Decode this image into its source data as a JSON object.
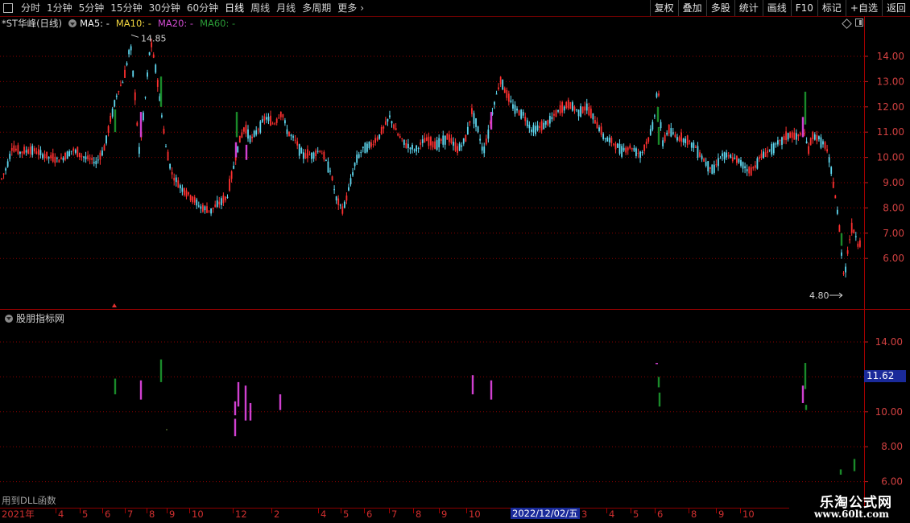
{
  "toolbar": {
    "tabs": [
      {
        "label": "分时"
      },
      {
        "label": "1分钟"
      },
      {
        "label": "5分钟"
      },
      {
        "label": "15分钟"
      },
      {
        "label": "30分钟"
      },
      {
        "label": "60分钟"
      },
      {
        "label": "日线",
        "active": true
      },
      {
        "label": "周线"
      },
      {
        "label": "月线"
      },
      {
        "label": "多周期"
      },
      {
        "label": "更多"
      }
    ],
    "right_buttons": [
      "复权",
      "叠加",
      "多股",
      "统计",
      "画线",
      "F10",
      "标记",
      "+自选",
      "返回"
    ]
  },
  "main": {
    "stock_name": "*ST华峰(日线)",
    "ma5": "MA5: -",
    "ma10": "MA10: -",
    "ma20": "MA20: -",
    "ma60": "MA60: -",
    "high_label": "14.85",
    "low_label": "4.80",
    "price_ticks": [
      "14.00",
      "13.00",
      "12.00",
      "11.00",
      "10.00",
      "9.00",
      "8.00",
      "7.00",
      "6.00"
    ]
  },
  "indicator": {
    "title": "股朋指标网",
    "ticks": [
      "14.00",
      "12.00",
      "10.00",
      "8.00",
      "6.00"
    ],
    "current_value": "11.62",
    "dll_note": "用到DLL函数"
  },
  "date_axis": {
    "labels": [
      "2021年",
      "4",
      "5",
      "6",
      "7",
      "8",
      "9",
      "10",
      "12",
      "2",
      "4",
      "5",
      "6",
      "7",
      "8",
      "9",
      "10",
      "3",
      "4",
      "5",
      "6",
      "8",
      "9",
      "10"
    ],
    "highlight": "2022/12/02/五"
  },
  "watermark": {
    "name": "乐淘公式网",
    "url": "www.60lt.com"
  },
  "colors": {
    "up": "#ff3030",
    "down": "#5fd8f0",
    "grid": "#8a0000",
    "signal_green": "#1a8a2a",
    "signal_magenta": "#d040d0"
  }
}
